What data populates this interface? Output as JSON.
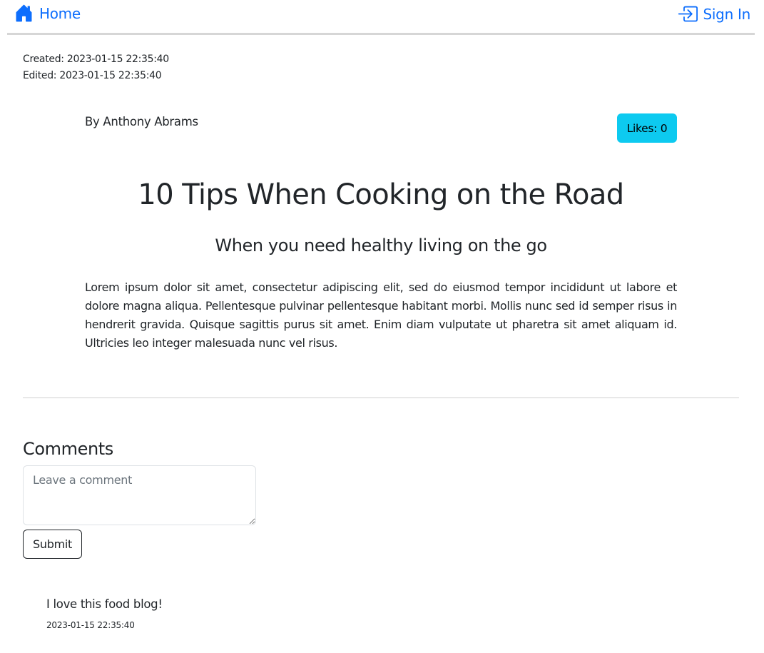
{
  "nav": {
    "home_label": "Home",
    "home_icon": "house-icon",
    "signin_label": "Sign In",
    "signin_icon": "sign-in-icon"
  },
  "colors": {
    "link": "#0d6efd",
    "likes_bg": "#0dcaf0"
  },
  "post": {
    "created": "Created: 2023-01-15 22:35:40",
    "edited": "Edited: 2023-01-15 22:35:40",
    "author": "By Anthony Abrams",
    "likes_label": "Likes: 0",
    "title": "10 Tips When Cooking on the Road",
    "subtitle": "When you need healthy living on the go",
    "body": "Lorem ipsum dolor sit amet, consectetur adipiscing elit, sed do eiusmod tempor incididunt ut labore et dolore magna aliqua. Pellentesque pulvinar pellentesque habitant morbi. Mollis nunc sed id semper risus in hendrerit gravida. Quisque sagittis purus sit amet. Enim diam vulputate ut pharetra sit amet aliquam id. Ultricies leo integer malesuada nunc vel risus."
  },
  "comments": {
    "heading": "Comments",
    "input_placeholder": "Leave a comment",
    "input_value": "",
    "submit_label": "Submit",
    "items": [
      {
        "text": "I love this food blog!",
        "date": "2023-01-15 22:35:40"
      }
    ]
  }
}
